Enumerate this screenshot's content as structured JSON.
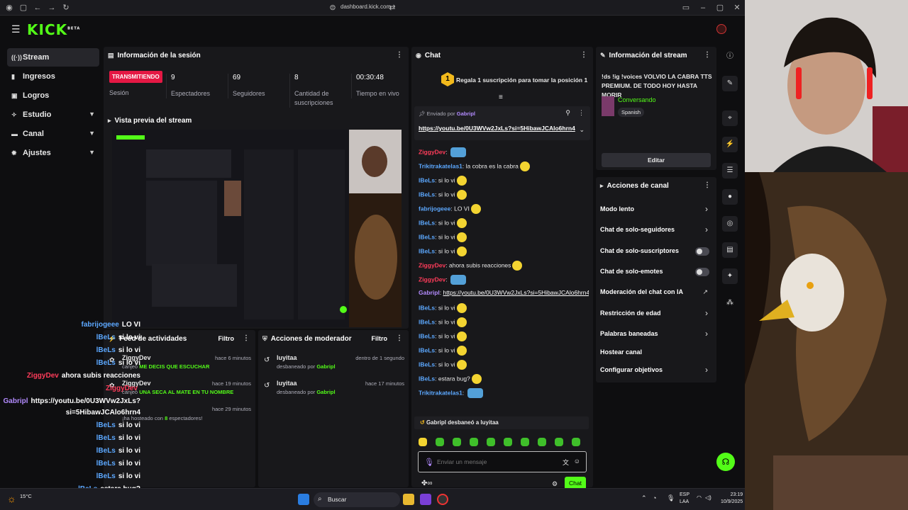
{
  "browser": {
    "url": "dashboard.kick.com"
  },
  "brand": {
    "logo": "KICK",
    "beta": "BETA",
    "accent": "#53fc18"
  },
  "sidenav": {
    "items": [
      {
        "icon": "stream-icon",
        "label": "Stream"
      },
      {
        "icon": "income-icon",
        "label": "Ingresos"
      },
      {
        "icon": "achievements-icon",
        "label": "Logros"
      },
      {
        "icon": "studio-icon",
        "label": "Estudio"
      },
      {
        "icon": "channel-icon",
        "label": "Canal"
      },
      {
        "icon": "settings-icon",
        "label": "Ajustes"
      }
    ]
  },
  "session": {
    "title": "Información de la sesión",
    "live_badge": "TRANSMITIENDO",
    "session_label": "Sesión",
    "viewers": "9",
    "viewers_label": "Espectadores",
    "followers": "69",
    "followers_label": "Seguidores",
    "subs": "8",
    "subs_label": "Cantidad de suscripciones",
    "uptime": "00:30:48",
    "uptime_label": "Tiempo en vivo"
  },
  "preview": {
    "title": "Vista previa del stream"
  },
  "activity": {
    "title": "Feed de actividades",
    "filter": "Filtro",
    "items": [
      {
        "user": "ZiggyDev",
        "time": "hace 6 minutos",
        "prefix": "canjeó",
        "reward": "ME DECIS QUE ESCUCHAR"
      },
      {
        "user": "ZiggyDev",
        "time": "hace 19 minutos",
        "prefix": "canjeó",
        "reward": "UNA SECA AL MATE EN TU NOMBRE"
      },
      {
        "user": "",
        "time": "hace 29 minutos",
        "prefix": "¡ha hosteado con",
        "reward": "8",
        "suffix": "espectadores!"
      }
    ]
  },
  "modactions": {
    "title": "Acciones de moderador",
    "filter": "Filtro",
    "items": [
      {
        "user": "luyitaa",
        "time": "dentro de 1 segundo",
        "action": "desbaneado por",
        "by": "Gabripl"
      },
      {
        "user": "luyitaa",
        "time": "hace 17 minutos",
        "action": "desbaneado por",
        "by": "Gabripl"
      }
    ]
  },
  "chat": {
    "title": "Chat",
    "gift_rank": "1",
    "gift_text": "Regala 1 suscripción para tomar la posición 1",
    "pinned_label": "Enviado por",
    "pinned_user": "Gabripl",
    "pinned_link": "https://youtu.be/0U3WVw2JxLs?si=5HibawJCAlo6hrn4",
    "messages": [
      {
        "user": "ZiggyDev",
        "cls": "u-red",
        "text": ""
      },
      {
        "user": "Trikitrakatelas1",
        "cls": "u-blue",
        "text": "la cobra es la cabra"
      },
      {
        "user": "lBeLs",
        "cls": "u-blue",
        "text": "si lo vi"
      },
      {
        "user": "lBeLs",
        "cls": "u-blue",
        "text": "si lo vi"
      },
      {
        "user": "fabrijogeee",
        "cls": "u-blue",
        "text": "LO VI"
      },
      {
        "user": "lBeLs",
        "cls": "u-blue",
        "text": "si lo vi"
      },
      {
        "user": "lBeLs",
        "cls": "u-blue",
        "text": "si lo vi"
      },
      {
        "user": "lBeLs",
        "cls": "u-blue",
        "text": "si lo vi"
      },
      {
        "user": "ZiggyDev",
        "cls": "u-red",
        "text": "ahora subis reacciones"
      },
      {
        "user": "ZiggyDev",
        "cls": "u-red",
        "text": ""
      },
      {
        "user": "Gabripl",
        "cls": "u-purple",
        "text": "https://youtu.be/0U3WVw2JxLs?si=5HibawJCAlo6hrn4"
      },
      {
        "user": "lBeLs",
        "cls": "u-blue",
        "text": "si lo vi"
      },
      {
        "user": "lBeLs",
        "cls": "u-blue",
        "text": "si lo vi"
      },
      {
        "user": "lBeLs",
        "cls": "u-blue",
        "text": "si lo vi"
      },
      {
        "user": "lBeLs",
        "cls": "u-blue",
        "text": "si lo vi"
      },
      {
        "user": "lBeLs",
        "cls": "u-blue",
        "text": "si lo vi"
      },
      {
        "user": "lBeLs",
        "cls": "u-blue",
        "text": "estara bug?"
      },
      {
        "user": "Trikitrakatelas1",
        "cls": "u-blue",
        "text": ""
      }
    ],
    "system": "Gabripl desbaneó a luyitaa",
    "input_placeholder": "Enviar un mensaje",
    "send": "Chat"
  },
  "streaminfo": {
    "title": "Información del stream",
    "stream_title": "!ds !ig !voices VOLVIO LA CABRA TTS PREMIUM. DE TODO HOY HASTA MORIR",
    "category": "Conversando",
    "language": "Spanish",
    "edit": "Editar"
  },
  "channel_actions": {
    "title": "Acciones de canal",
    "items": [
      {
        "label": "Modo lento",
        "type": "arrow"
      },
      {
        "label": "Chat de solo-seguidores",
        "type": "arrow"
      },
      {
        "label": "Chat de solo-suscriptores",
        "type": "toggle"
      },
      {
        "label": "Chat de solo-emotes",
        "type": "toggle"
      },
      {
        "label": "Moderación del chat con IA",
        "type": "ext"
      },
      {
        "label": "Restricción de edad",
        "type": "arrow"
      },
      {
        "label": "Palabras baneadas",
        "type": "arrow"
      },
      {
        "label": "Hostear canal",
        "type": "none"
      },
      {
        "label": "Configurar objetivos",
        "type": "arrow"
      }
    ]
  },
  "overlay_chat": [
    {
      "user": "fabrijogeee",
      "cls": "u-blue",
      "text": "LO VI"
    },
    {
      "user": "lBeLs",
      "cls": "u-blue",
      "text": "si lo vi"
    },
    {
      "user": "lBeLs",
      "cls": "u-blue",
      "text": "si lo vi"
    },
    {
      "user": "lBeLs",
      "cls": "u-blue",
      "text": "si lo vi"
    },
    {
      "user": "ZiggyDev",
      "cls": "u-red",
      "text": "ahora subis reacciones"
    },
    {
      "user": "ZiggyDev",
      "cls": "u-red",
      "text": ""
    },
    {
      "user": "Gabripl",
      "cls": "u-purple",
      "text": "https://youtu.be/0U3WVw2JxLs?"
    },
    {
      "user": "",
      "cls": "u-blue",
      "text": "si=5HibawJCAlo6hrn4"
    },
    {
      "user": "lBeLs",
      "cls": "u-blue",
      "text": "si lo vi"
    },
    {
      "user": "lBeLs",
      "cls": "u-blue",
      "text": "si lo vi"
    },
    {
      "user": "lBeLs",
      "cls": "u-blue",
      "text": "si lo vi"
    },
    {
      "user": "lBeLs",
      "cls": "u-blue",
      "text": "si lo vi"
    },
    {
      "user": "lBeLs",
      "cls": "u-blue",
      "text": "si lo vi"
    },
    {
      "user": "lBeLs",
      "cls": "u-blue",
      "text": "estara bug?"
    },
    {
      "user": "Trikitrakatelas1",
      "cls": "u-blue",
      "text": ""
    }
  ],
  "taskbar": {
    "weather": "15°C",
    "search": "Buscar",
    "lang1": "ESP",
    "lang2": "LAA",
    "time": "23:19",
    "date": "10/9/2025"
  }
}
